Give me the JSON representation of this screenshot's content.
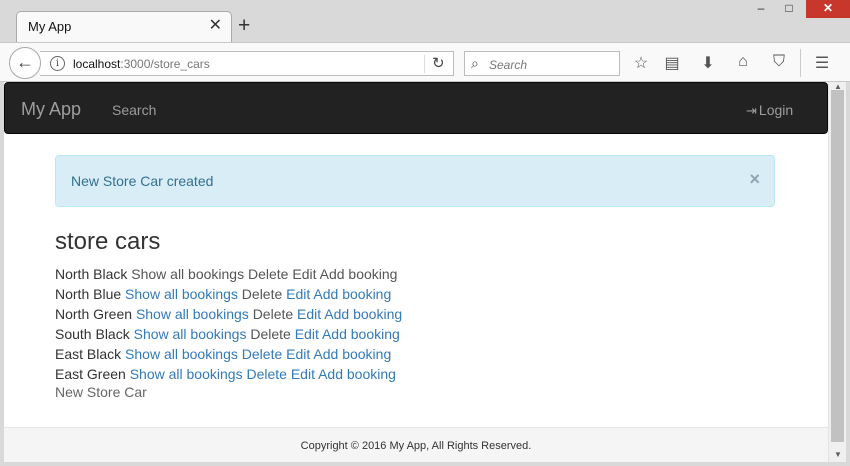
{
  "browser": {
    "tab_title": "My App",
    "tab_close_glyph": "✕",
    "new_tab_glyph": "+",
    "window_min_glyph": "–",
    "window_max_glyph": "□",
    "window_close_glyph": "✕",
    "url_host": "localhost",
    "url_rest": ":3000/store_cars",
    "search_placeholder": "Search",
    "icons": [
      "back-arrow-icon",
      "info-icon",
      "reload-icon",
      "search-icon",
      "bookmark-star-icon",
      "reading-list-icon",
      "download-icon",
      "home-icon",
      "pocket-icon",
      "menu-icon"
    ]
  },
  "app": {
    "brand": "My App",
    "nav_search": "Search",
    "nav_login": "Login",
    "alert_message": "New Store Car created",
    "alert_close": "×",
    "heading": "store cars",
    "cars": [
      {
        "name": "North Black",
        "show": "Show all bookings",
        "delete": "Delete",
        "edit": "Edit",
        "add": "Add booking"
      },
      {
        "name": "North Blue",
        "show": "Show all bookings",
        "delete": "Delete",
        "edit": "Edit",
        "add": "Add booking"
      },
      {
        "name": "North Green",
        "show": "Show all bookings",
        "delete": "Delete",
        "edit": "Edit",
        "add": "Add booking"
      },
      {
        "name": "South Black",
        "show": "Show all bookings",
        "delete": "Delete",
        "edit": "Edit",
        "add": "Add booking"
      },
      {
        "name": "East Black",
        "show": "Show all bookings",
        "delete": "Delete",
        "edit": "Edit",
        "add": "Add booking"
      },
      {
        "name": "East Green",
        "show": "Show all bookings",
        "delete": "Delete",
        "edit": "Edit",
        "add": "Add booking"
      }
    ],
    "new_store_car": "New Store Car",
    "footer": "Copyright © 2016 My App, All Rights Reserved."
  },
  "colors": {
    "navbar_bg": "#222222",
    "link": "#337ab7",
    "alert_bg": "#d9edf7",
    "alert_text": "#31708f"
  }
}
